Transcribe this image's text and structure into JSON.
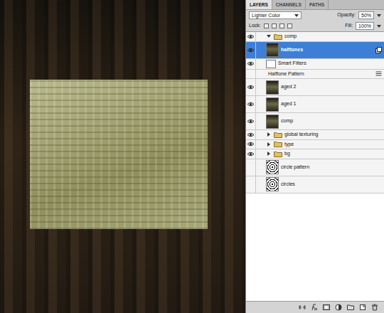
{
  "panel": {
    "tabs": [
      {
        "label": "LAYERS",
        "selected": true
      },
      {
        "label": "CHANNELS",
        "selected": false
      },
      {
        "label": "PATHS",
        "selected": false
      }
    ],
    "blend_mode": "Lighter Color",
    "opacity_label": "Opacity:",
    "opacity": "50%",
    "lock_label": "Lock:",
    "fill_label": "Fill:",
    "fill": "100%"
  },
  "layers": [
    {
      "name": "comp",
      "kind": "group",
      "visible": true,
      "expanded": true,
      "selected": false,
      "nested": false
    },
    {
      "name": "halftones",
      "kind": "smart-object",
      "visible": true,
      "expanded": false,
      "selected": true,
      "nested": true
    },
    {
      "name": "Smart Filters",
      "kind": "filter-group",
      "visible": true,
      "expanded": false,
      "selected": false,
      "nested": true
    },
    {
      "name": "Halftone Pattern",
      "kind": "filter",
      "visible": false,
      "expanded": false,
      "selected": false,
      "nested": true
    },
    {
      "name": "aged 2",
      "kind": "layer",
      "visible": true,
      "expanded": false,
      "selected": false,
      "nested": true
    },
    {
      "name": "aged 1",
      "kind": "layer",
      "visible": true,
      "expanded": false,
      "selected": false,
      "nested": true
    },
    {
      "name": "comp",
      "kind": "layer",
      "visible": true,
      "expanded": false,
      "selected": false,
      "nested": true
    },
    {
      "name": "global texturing",
      "kind": "group",
      "visible": true,
      "expanded": false,
      "selected": false,
      "nested": false
    },
    {
      "name": "type",
      "kind": "group",
      "visible": true,
      "expanded": false,
      "selected": false,
      "nested": false
    },
    {
      "name": "bg",
      "kind": "group",
      "visible": true,
      "expanded": false,
      "selected": false,
      "nested": false
    },
    {
      "name": "circle pattern",
      "kind": "pattern",
      "visible": false,
      "expanded": false,
      "selected": false,
      "nested": false
    },
    {
      "name": "circles",
      "kind": "pattern",
      "visible": false,
      "expanded": false,
      "selected": false,
      "nested": false
    }
  ]
}
